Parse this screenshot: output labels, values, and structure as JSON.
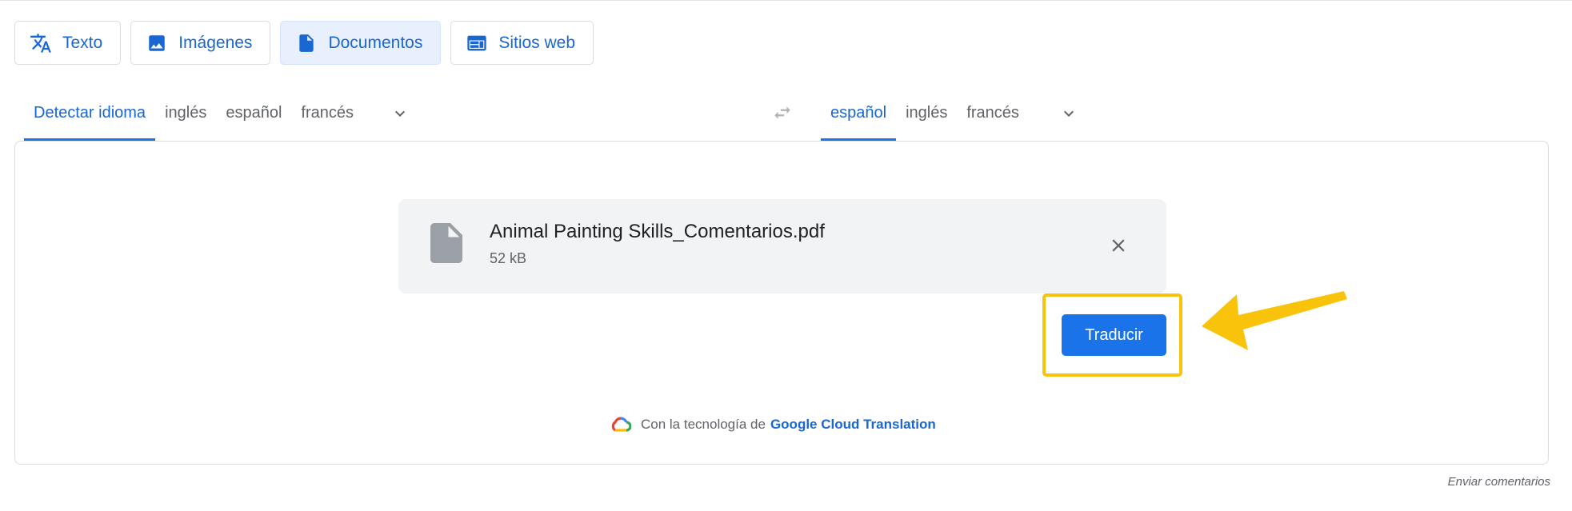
{
  "mode_tabs": [
    {
      "label": "Texto",
      "icon": "translate-icon",
      "active": false
    },
    {
      "label": "Imágenes",
      "icon": "image-icon",
      "active": false
    },
    {
      "label": "Documentos",
      "icon": "document-icon",
      "active": true
    },
    {
      "label": "Sitios web",
      "icon": "website-icon",
      "active": false
    }
  ],
  "source_languages": [
    "Detectar idioma",
    "inglés",
    "español",
    "francés"
  ],
  "target_languages": [
    "español",
    "inglés",
    "francés"
  ],
  "file": {
    "name": "Animal Painting Skills_Comentarios.pdf",
    "size": "52 kB"
  },
  "translate_button": "Traducir",
  "powered_by": {
    "prefix": "Con la tecnología de",
    "link": "Google Cloud Translation"
  },
  "feedback": "Enviar comentarios",
  "colors": {
    "accent": "#1a73e8",
    "highlight": "#f9c20b"
  }
}
